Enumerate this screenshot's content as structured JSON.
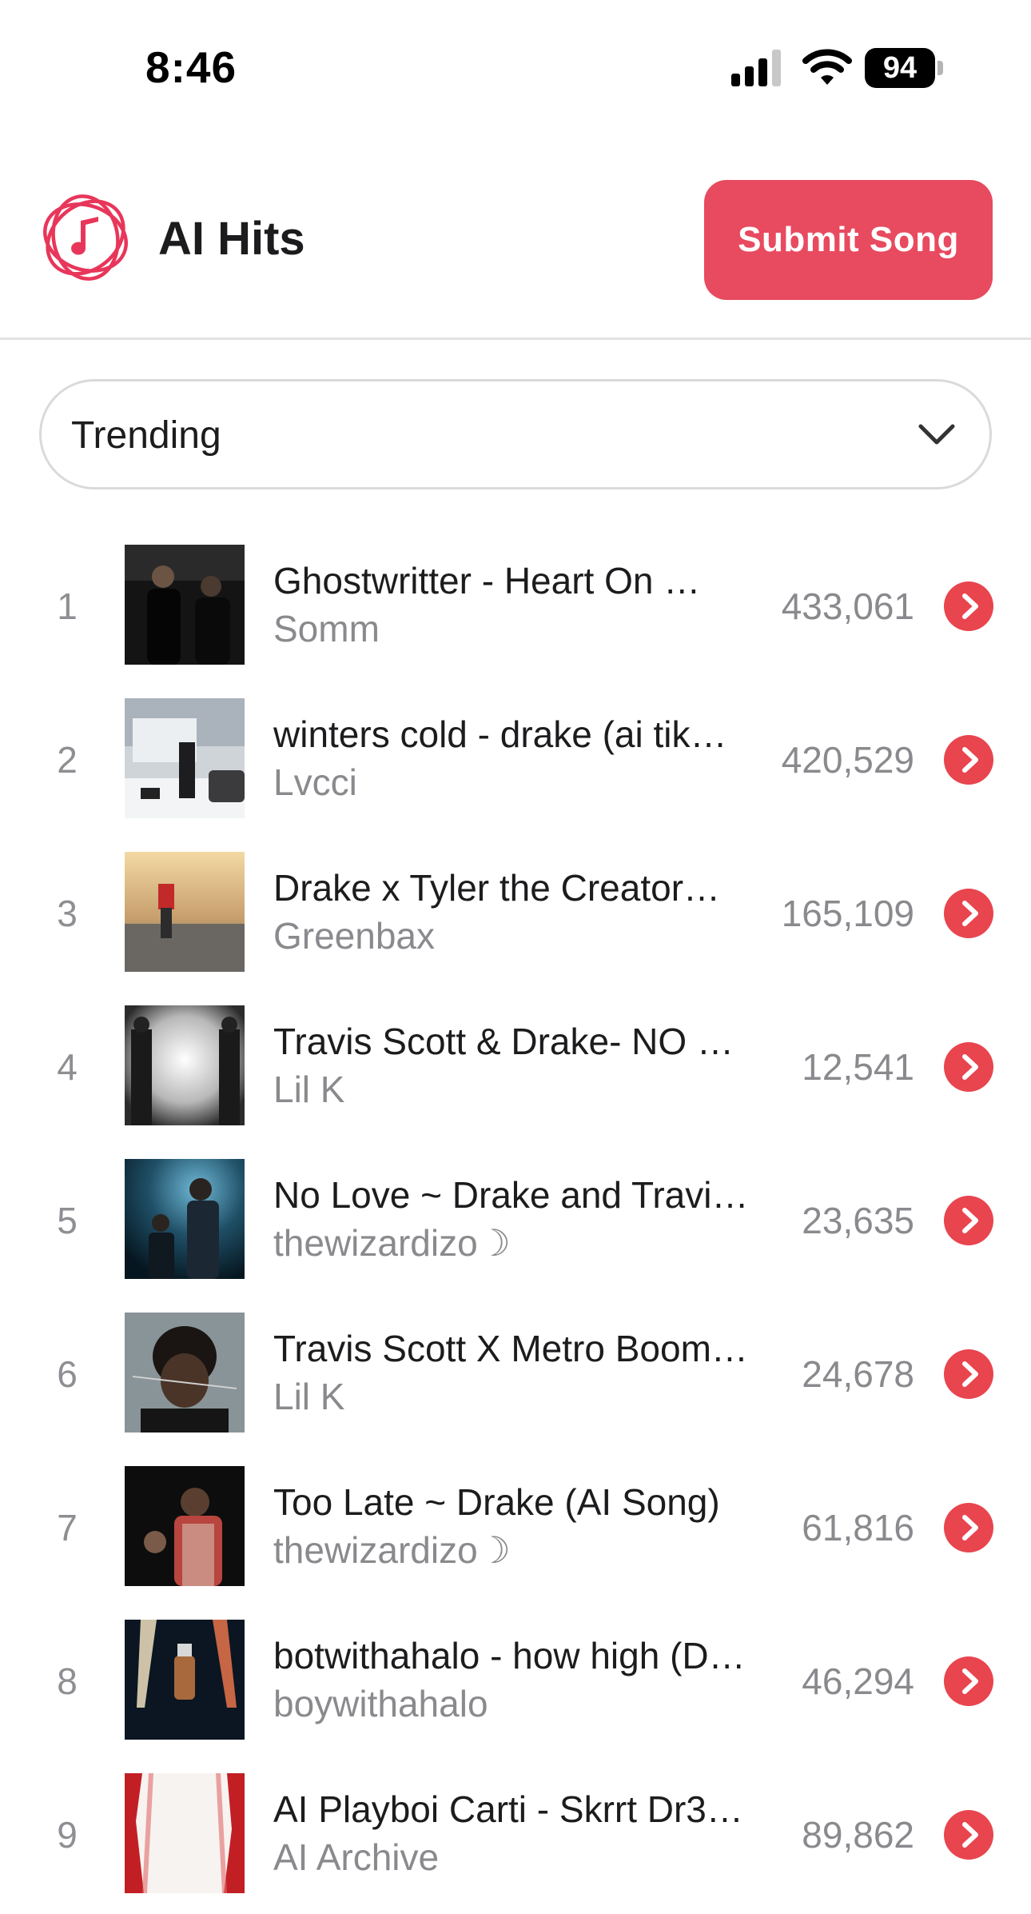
{
  "status_bar": {
    "time": "8:46",
    "battery": "94",
    "icons": [
      "signal-icon",
      "wifi-icon",
      "battery-icon"
    ]
  },
  "header": {
    "logo_icon": "music-note-logo-icon",
    "title": "AI Hits",
    "submit_label": "Submit Song"
  },
  "filter": {
    "selected": "Trending",
    "icon": "chevron-down-icon"
  },
  "colors": {
    "accent": "#e84a5f",
    "play": "#e8454f",
    "muted_text": "#8a8a8e"
  },
  "songs": [
    {
      "rank": "1",
      "title": "Ghostwritter - Heart On …",
      "artist": "Somm",
      "plays": "433,061"
    },
    {
      "rank": "2",
      "title": "winters cold - drake (ai tik…",
      "artist": "Lvcci",
      "plays": "420,529"
    },
    {
      "rank": "3",
      "title": "Drake x Tyler the Creator…",
      "artist": "Greenbax",
      "plays": "165,109"
    },
    {
      "rank": "4",
      "title": "Travis Scott & Drake- NO …",
      "artist": "Lil K",
      "plays": "12,541"
    },
    {
      "rank": "5",
      "title": "No Love ~ Drake and Travi…",
      "artist": "thewizardizo☽",
      "plays": "23,635"
    },
    {
      "rank": "6",
      "title": "Travis Scott X Metro Boom…",
      "artist": "Lil K",
      "plays": "24,678"
    },
    {
      "rank": "7",
      "title": "Too Late ~ Drake (AI Song)",
      "artist": "thewizardizo☽",
      "plays": "61,816"
    },
    {
      "rank": "8",
      "title": "botwithahalo - how high (D…",
      "artist": "boywithahalo",
      "plays": "46,294"
    },
    {
      "rank": "9",
      "title": "AI Playboi Carti - Skrrt Dr3…",
      "artist": "AI Archive",
      "plays": "89,862"
    }
  ]
}
